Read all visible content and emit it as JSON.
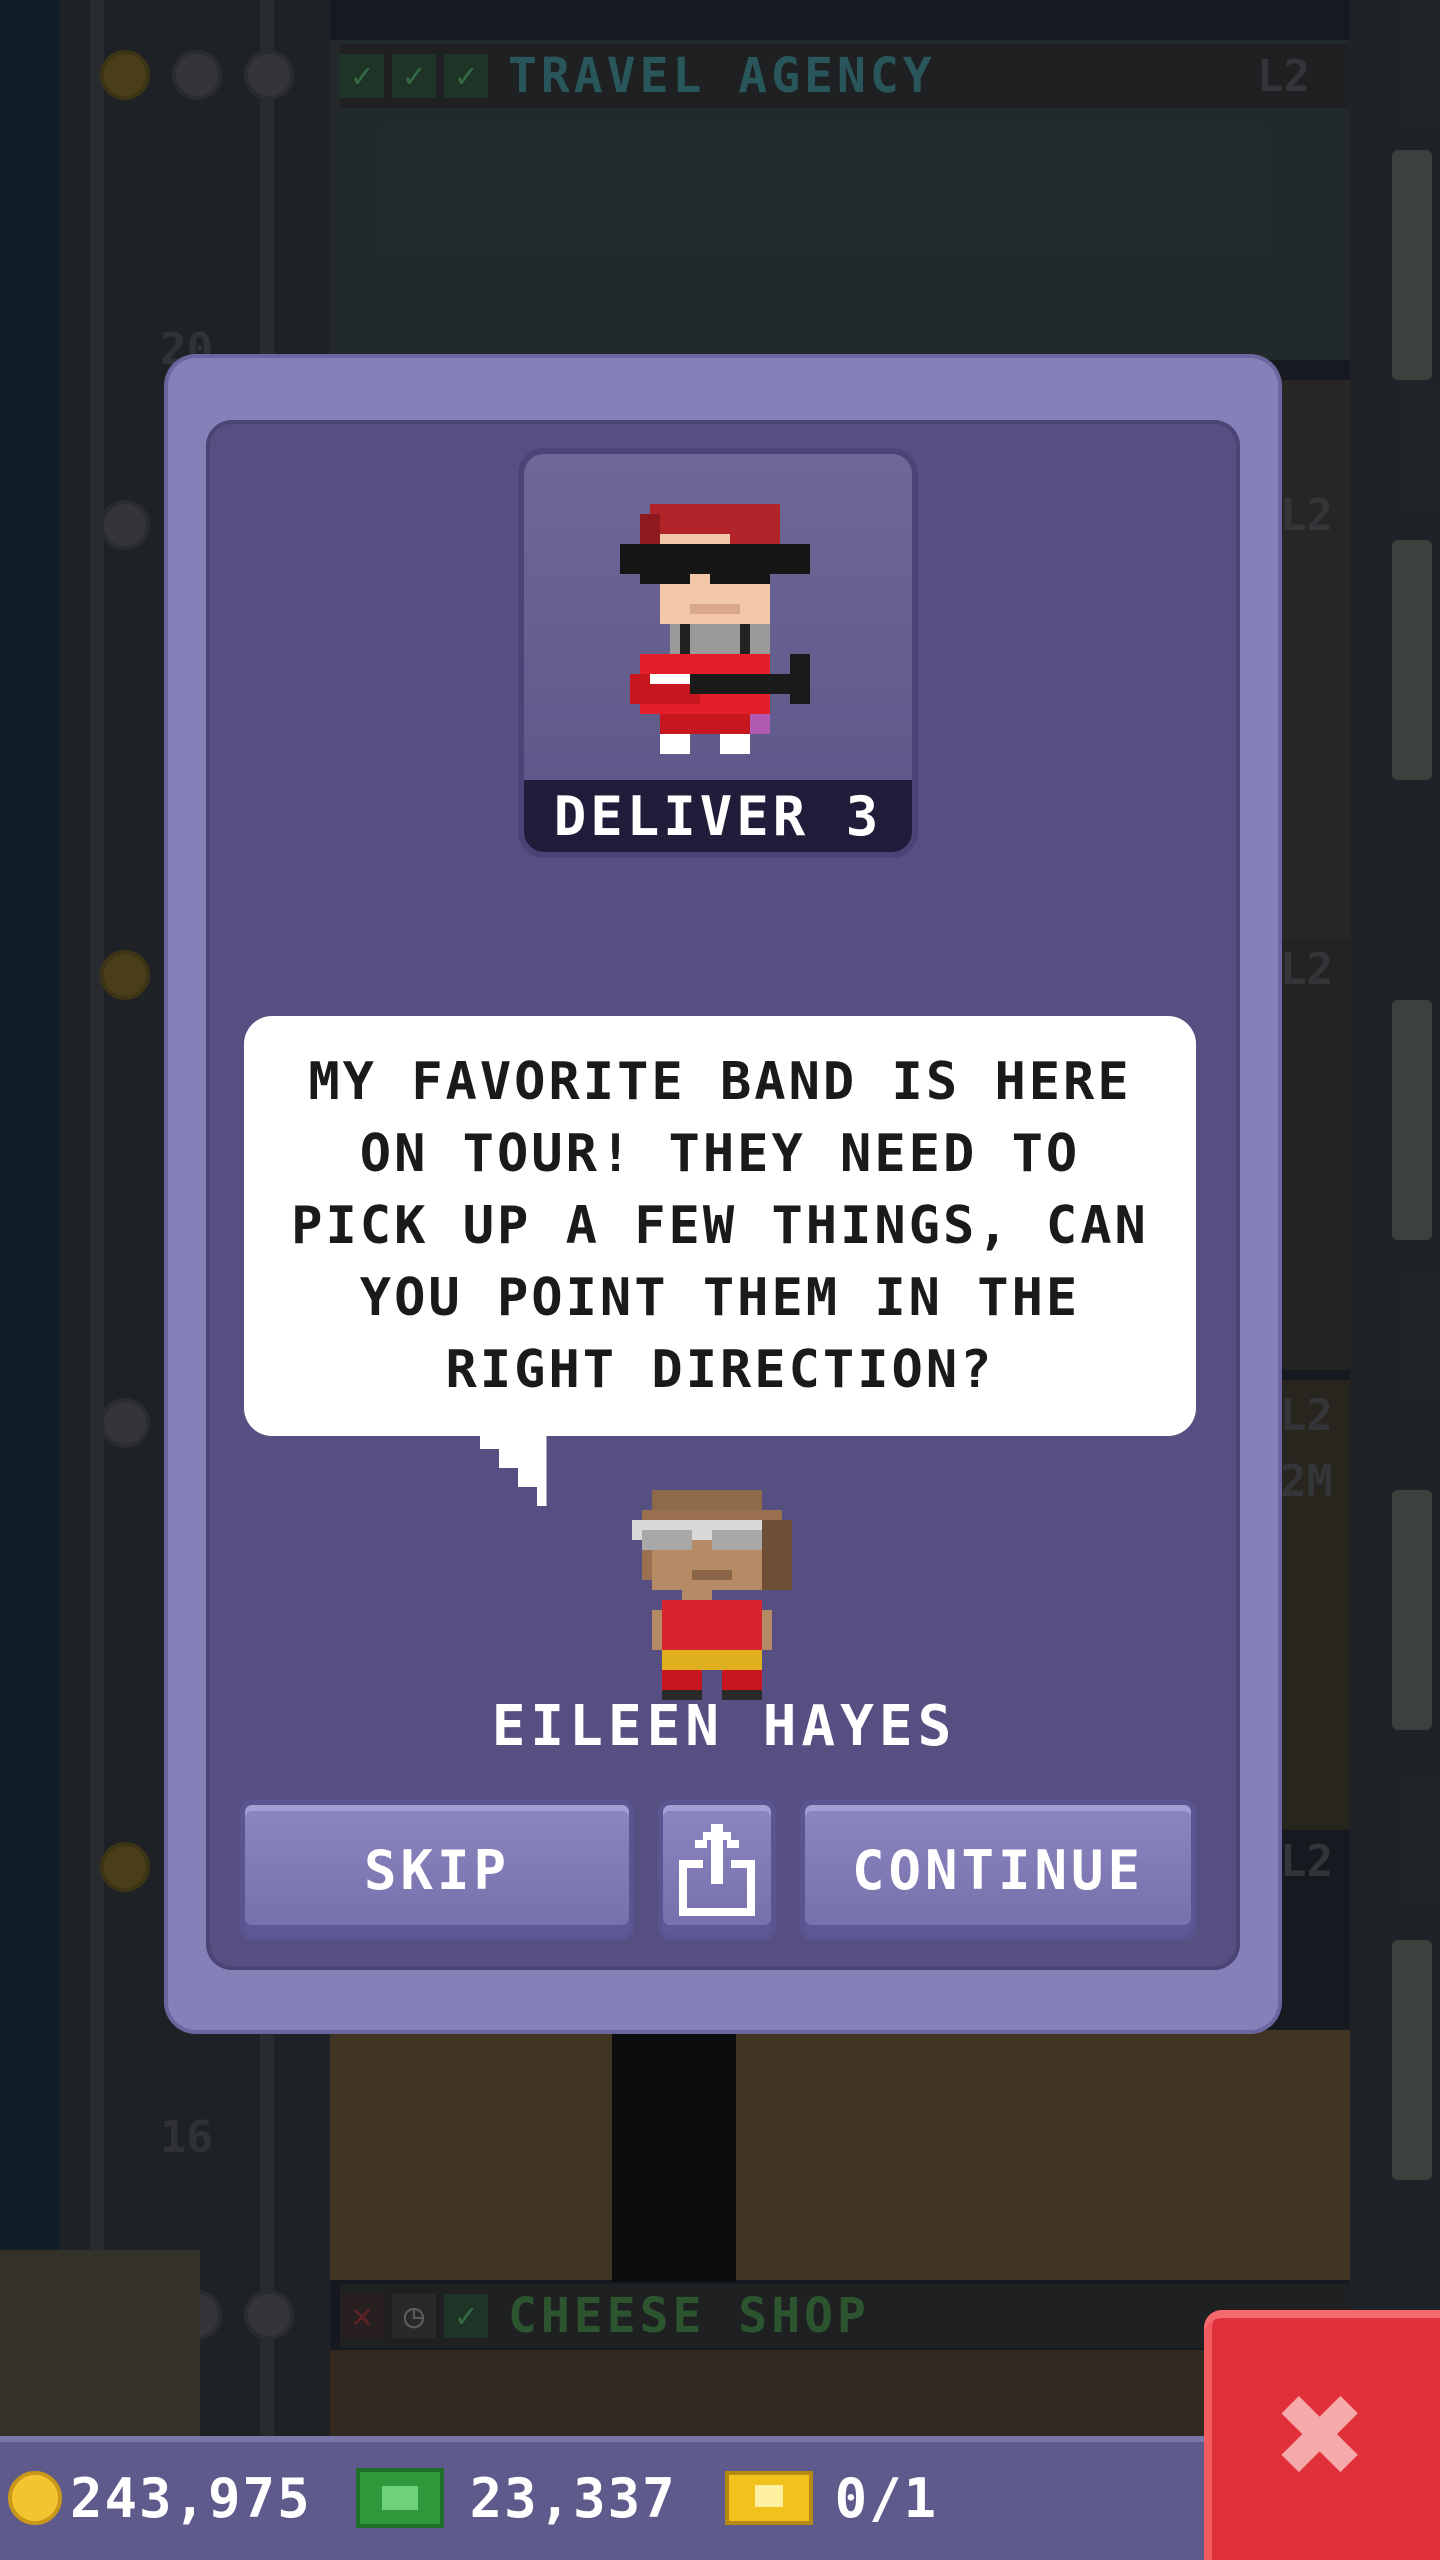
{
  "background": {
    "floors": [
      {
        "name": "TRAVEL AGENCY",
        "level": "L2",
        "status": [
          "check",
          "check",
          "check"
        ],
        "name_color": "#3a7f82"
      },
      {
        "name": "CHEESE SHOP",
        "level": "",
        "status": [
          "x",
          "clock",
          "check"
        ],
        "name_color": "#3f7d3f"
      }
    ],
    "floor_numbers": [
      "20",
      "16"
    ],
    "side_levels": [
      "L2",
      "L2",
      "L2",
      "L2",
      "2M"
    ]
  },
  "quest": {
    "label": "DELIVER 3"
  },
  "dialog": {
    "lines": [
      "MY FAVORITE BAND IS HERE",
      "ON TOUR! THEY NEED TO",
      "PICK UP A FEW THINGS, CAN",
      "YOU POINT THEM IN THE",
      "RIGHT DIRECTION?"
    ],
    "speaker": "EILEEN HAYES"
  },
  "buttons": {
    "skip": "SKIP",
    "continue": "CONTINUE",
    "share_icon": "share-icon"
  },
  "hud": {
    "coins": "243,975",
    "bux": "23,337",
    "tickets": "0/1"
  },
  "colors": {
    "modal_outer": "#8680b8",
    "modal_inner": "#565082",
    "close_red": "#e0313a"
  }
}
